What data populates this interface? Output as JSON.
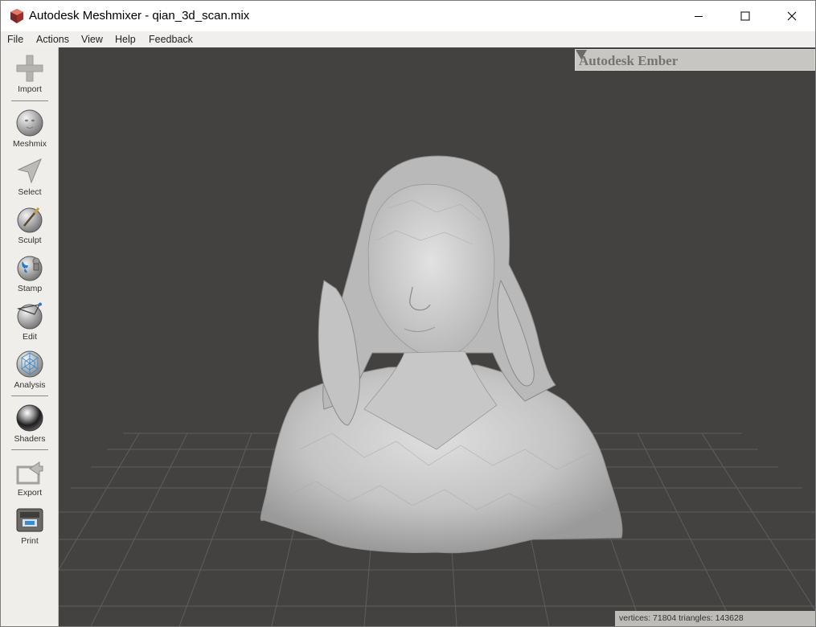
{
  "window": {
    "title": "Autodesk Meshmixer - qian_3d_scan.mix",
    "controls": {
      "minimize": "minimize",
      "maximize": "maximize",
      "close": "close"
    }
  },
  "menu": {
    "items": [
      "File",
      "Actions",
      "View",
      "Help",
      "Feedback"
    ]
  },
  "toolbar": {
    "tools": [
      {
        "label": "Import",
        "icon": "plus-icon"
      },
      {
        "label": "Meshmix",
        "icon": "face-sphere-icon"
      },
      {
        "label": "Select",
        "icon": "arrow-cursor-icon"
      },
      {
        "label": "Sculpt",
        "icon": "brush-sphere-icon"
      },
      {
        "label": "Stamp",
        "icon": "fleur-stamp-icon"
      },
      {
        "label": "Edit",
        "icon": "edit-sphere-icon"
      },
      {
        "label": "Analysis",
        "icon": "wireframe-sphere-icon"
      },
      {
        "label": "Shaders",
        "icon": "chrome-sphere-icon"
      },
      {
        "label": "Export",
        "icon": "export-arrow-icon"
      },
      {
        "label": "Print",
        "icon": "printer-icon"
      }
    ]
  },
  "panel": {
    "title": "Autodesk Ember"
  },
  "status": {
    "text": "vertices: 71804 triangles: 143628"
  },
  "colors": {
    "viewport_bg": "#434241",
    "grid_line": "#6a6968",
    "mesh": "#c9c9c9",
    "panel_bg": "#c8c6c3",
    "toolbar_bg": "#f0eeeb"
  }
}
